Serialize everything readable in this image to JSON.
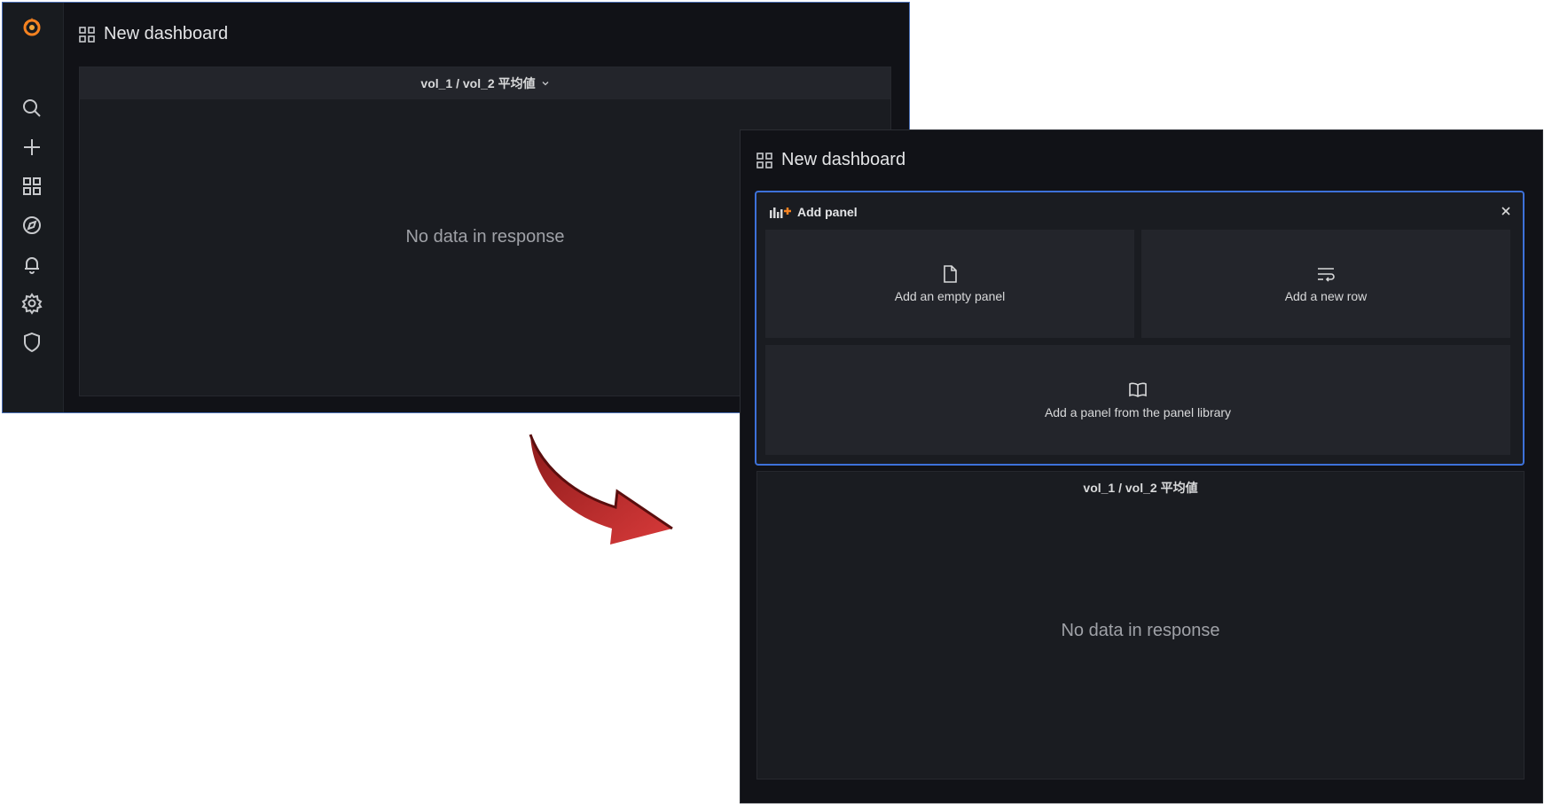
{
  "before": {
    "dashboard_title": "New dashboard",
    "panel": {
      "title": "vol_1 / vol_2 平均値",
      "empty_message": "No data in response"
    },
    "sidebar_icons": [
      "grafana-logo-icon",
      "search-icon",
      "plus-icon",
      "dashboards-icon",
      "explore-icon",
      "bell-icon",
      "gear-icon",
      "shield-icon"
    ]
  },
  "after": {
    "dashboard_title": "New dashboard",
    "add_panel": {
      "header": "Add panel",
      "options": {
        "empty_panel": "Add an empty panel",
        "new_row": "Add a new row",
        "from_library": "Add a panel from the panel library"
      }
    },
    "panel": {
      "title": "vol_1 / vol_2 平均値",
      "empty_message": "No data in response"
    }
  },
  "colors": {
    "background": "#111217",
    "panel": "#1a1c21",
    "accent_border": "#3d71d9",
    "logo_orange": "#f58220",
    "arrow_red": "#c92a2a"
  }
}
